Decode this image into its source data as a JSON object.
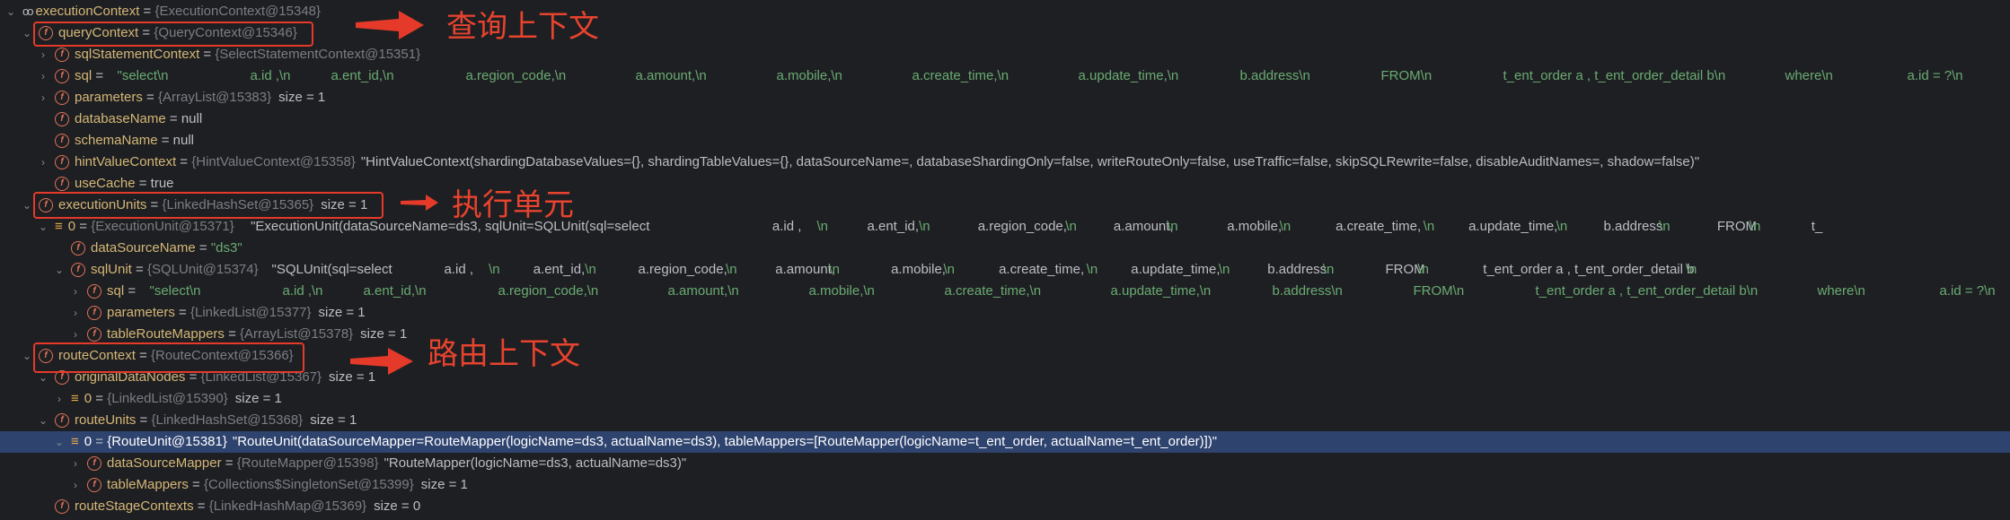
{
  "colors": {
    "background": "#1e1f22",
    "selected_row": "#2e436e",
    "field_name": "#d5b778",
    "type_ref": "#7a7e85",
    "string": "#6aab73",
    "annotation": "#e53a2a"
  },
  "rows": [
    {
      "depth": 0,
      "arrow": "down",
      "icon": "watch",
      "name": "executionContext",
      "type": "{ExecutionContext@15348}"
    },
    {
      "depth": 1,
      "arrow": "down",
      "icon": "field",
      "name": "queryContext",
      "type": "{QueryContext@15346}"
    },
    {
      "depth": 2,
      "arrow": "right",
      "icon": "field",
      "name": "sqlStatementContext",
      "type": "{SelectStatementContext@15351}"
    },
    {
      "depth": 2,
      "arrow": "right",
      "icon": "field",
      "name": "sql",
      "string_segments": [
        {
          "text": "\"select\\n",
          "offset": 0
        },
        {
          "text": "a.id ,\\n",
          "offset": 148
        },
        {
          "text": "a.ent_id,\\n",
          "offset": 238
        },
        {
          "text": "a.region_code,\\n",
          "offset": 388
        },
        {
          "text": "a.amount,\\n",
          "offset": 577
        },
        {
          "text": "a.mobile,\\n",
          "offset": 734
        },
        {
          "text": "a.create_time,\\n",
          "offset": 885
        },
        {
          "text": "a.update_time,\\n",
          "offset": 1070
        },
        {
          "text": "b.address\\n",
          "offset": 1250
        },
        {
          "text": "FROM\\n",
          "offset": 1407
        },
        {
          "text": "t_ent_order a , t_ent_order_detail b\\n",
          "offset": 1543
        },
        {
          "text": "where\\n",
          "offset": 1857
        },
        {
          "text": "a.id = ?\\n",
          "offset": 1993
        }
      ]
    },
    {
      "depth": 2,
      "arrow": "right",
      "icon": "field",
      "name": "parameters",
      "type": "{ArrayList@15383}",
      "size": "size = 1"
    },
    {
      "depth": 2,
      "arrow": "",
      "icon": "field",
      "name": "databaseName",
      "value": "null"
    },
    {
      "depth": 2,
      "arrow": "",
      "icon": "field",
      "name": "schemaName",
      "value": "null"
    },
    {
      "depth": 2,
      "arrow": "right",
      "icon": "field",
      "name": "hintValueContext",
      "type": "{HintValueContext@15358}",
      "value": "\"HintValueContext(shardingDatabaseValues={}, shardingTableValues={}, dataSourceName=, databaseShardingOnly=false, writeRouteOnly=false, useTraffic=false, skipSQLRewrite=false, disableAuditNames=, shadow=false)\""
    },
    {
      "depth": 2,
      "arrow": "",
      "icon": "field",
      "name": "useCache",
      "value": "true"
    },
    {
      "depth": 1,
      "arrow": "down",
      "icon": "field",
      "name": "executionUnits",
      "type": "{LinkedHashSet@15365}",
      "size": "size = 1"
    },
    {
      "depth": 2,
      "arrow": "down",
      "icon": "array",
      "name": "0",
      "type": "{ExecutionUnit@15371}",
      "value_segments": [
        {
          "text": "\"ExecutionUnit(dataSourceName=ds3, sqlUnit=SQLUnit(sql=select",
          "offset": 0,
          "cls": "val"
        },
        {
          "text": "a.id ,",
          "offset": 726,
          "cls": "val"
        },
        {
          "text": "\\n",
          "offset": 788,
          "cls": "str"
        },
        {
          "text": "a.ent_id,",
          "offset": 858,
          "cls": "val"
        },
        {
          "text": "\\n",
          "offset": 930,
          "cls": "str"
        },
        {
          "text": "a.region_code,",
          "offset": 1012,
          "cls": "val"
        },
        {
          "text": "\\n",
          "offset": 1134,
          "cls": "str"
        },
        {
          "text": "a.amount,",
          "offset": 1201,
          "cls": "val"
        },
        {
          "text": "\\n",
          "offset": 1275,
          "cls": "str"
        },
        {
          "text": "a.mobile,",
          "offset": 1359,
          "cls": "val"
        },
        {
          "text": "\\n",
          "offset": 1432,
          "cls": "str"
        },
        {
          "text": "a.create_time,",
          "offset": 1510,
          "cls": "val"
        },
        {
          "text": "\\n",
          "offset": 1632,
          "cls": "str"
        },
        {
          "text": "a.update_time,",
          "offset": 1695,
          "cls": "val"
        },
        {
          "text": "\\n",
          "offset": 1817,
          "cls": "str"
        },
        {
          "text": "b.address",
          "offset": 1883,
          "cls": "val"
        },
        {
          "text": "\\n",
          "offset": 1960,
          "cls": "str"
        },
        {
          "text": "FROM",
          "offset": 2041,
          "cls": "val"
        },
        {
          "text": "\\n",
          "offset": 2086,
          "cls": "str"
        },
        {
          "text": "t_",
          "offset": 2172,
          "cls": "val"
        }
      ]
    },
    {
      "depth": 3,
      "arrow": "",
      "icon": "field",
      "name": "dataSourceName",
      "string": "\"ds3\""
    },
    {
      "depth": 3,
      "arrow": "down",
      "icon": "field",
      "name": "sqlUnit",
      "type": "{SQLUnit@15374}",
      "value_segments": [
        {
          "text": "\"SQLUnit(sql=select",
          "offset": 0,
          "cls": "val"
        },
        {
          "text": "a.id ,",
          "offset": 240,
          "cls": "val"
        },
        {
          "text": "\\n",
          "offset": 302,
          "cls": "str"
        },
        {
          "text": "a.ent_id,",
          "offset": 364,
          "cls": "val"
        },
        {
          "text": "\\n",
          "offset": 436,
          "cls": "str"
        },
        {
          "text": "a.region_code,",
          "offset": 510,
          "cls": "val"
        },
        {
          "text": "\\n",
          "offset": 632,
          "cls": "str"
        },
        {
          "text": "a.amount,",
          "offset": 701,
          "cls": "val"
        },
        {
          "text": "\\n",
          "offset": 775,
          "cls": "str"
        },
        {
          "text": "a.mobile,",
          "offset": 862,
          "cls": "val"
        },
        {
          "text": "\\n",
          "offset": 935,
          "cls": "str"
        },
        {
          "text": "a.create_time,",
          "offset": 1012,
          "cls": "val"
        },
        {
          "text": "\\n",
          "offset": 1134,
          "cls": "str"
        },
        {
          "text": "a.update_time,",
          "offset": 1196,
          "cls": "val"
        },
        {
          "text": "\\n",
          "offset": 1318,
          "cls": "str"
        },
        {
          "text": "b.address",
          "offset": 1386,
          "cls": "val"
        },
        {
          "text": "\\n",
          "offset": 1463,
          "cls": "str"
        },
        {
          "text": "FROM",
          "offset": 1550,
          "cls": "val"
        },
        {
          "text": "\\n",
          "offset": 1595,
          "cls": "str"
        },
        {
          "text": "t_ent_order a , t_ent_order_detail b",
          "offset": 1686,
          "cls": "val"
        },
        {
          "text": "\\n",
          "offset": 1968,
          "cls": "str"
        }
      ]
    },
    {
      "depth": 4,
      "arrow": "right",
      "icon": "field",
      "name": "sql",
      "string_segments": [
        {
          "text": "\"select\\n",
          "offset": 0
        },
        {
          "text": "a.id ,\\n",
          "offset": 148
        },
        {
          "text": "a.ent_id,\\n",
          "offset": 238
        },
        {
          "text": "a.region_code,\\n",
          "offset": 388
        },
        {
          "text": "a.amount,\\n",
          "offset": 577
        },
        {
          "text": "a.mobile,\\n",
          "offset": 734
        },
        {
          "text": "a.create_time,\\n",
          "offset": 885
        },
        {
          "text": "a.update_time,\\n",
          "offset": 1070
        },
        {
          "text": "b.address\\n",
          "offset": 1250
        },
        {
          "text": "FROM\\n",
          "offset": 1407
        },
        {
          "text": "t_ent_order a , t_ent_order_detail b\\n",
          "offset": 1543
        },
        {
          "text": "where\\n",
          "offset": 1857
        },
        {
          "text": "a.id = ?\\n",
          "offset": 1993
        }
      ]
    },
    {
      "depth": 4,
      "arrow": "right",
      "icon": "field",
      "name": "parameters",
      "type": "{LinkedList@15377}",
      "size": "size = 1"
    },
    {
      "depth": 4,
      "arrow": "right",
      "icon": "field",
      "name": "tableRouteMappers",
      "type": "{ArrayList@15378}",
      "size": "size = 1"
    },
    {
      "depth": 1,
      "arrow": "down",
      "icon": "field",
      "name": "routeContext",
      "type": "{RouteContext@15366}"
    },
    {
      "depth": 2,
      "arrow": "down",
      "icon": "field",
      "name": "originalDataNodes",
      "type": "{LinkedList@15367}",
      "size": "size = 1"
    },
    {
      "depth": 3,
      "arrow": "right",
      "icon": "array",
      "name": "0",
      "type": "{LinkedList@15390}",
      "size": "size = 1"
    },
    {
      "depth": 2,
      "arrow": "down",
      "icon": "field",
      "name": "routeUnits",
      "type": "{LinkedHashSet@15368}",
      "size": "size = 1"
    },
    {
      "depth": 3,
      "arrow": "down",
      "icon": "array",
      "name": "0",
      "type": "{RouteUnit@15381}",
      "type_plain": true,
      "selected": true,
      "value": "\"RouteUnit(dataSourceMapper=RouteMapper(logicName=ds3, actualName=ds3), tableMappers=[RouteMapper(logicName=t_ent_order, actualName=t_ent_order)])\""
    },
    {
      "depth": 4,
      "arrow": "right",
      "icon": "field",
      "name": "dataSourceMapper",
      "type": "{RouteMapper@15398}",
      "value": "\"RouteMapper(logicName=ds3, actualName=ds3)\""
    },
    {
      "depth": 4,
      "arrow": "right",
      "icon": "field",
      "name": "tableMappers",
      "type": "{Collections$SingletonSet@15399}",
      "size": "size = 1"
    },
    {
      "depth": 2,
      "arrow": "",
      "icon": "field",
      "name": "routeStageContexts",
      "type": "{LinkedHashMap@15369}",
      "size": "size = 0"
    }
  ],
  "annotations": {
    "query_label": "查询上下文",
    "exec_label": "执行单元",
    "route_label": "路由上下文"
  },
  "icons": {
    "field": "f",
    "array": "≡",
    "watch": "oo",
    "down": "⌄",
    "right": "›"
  }
}
